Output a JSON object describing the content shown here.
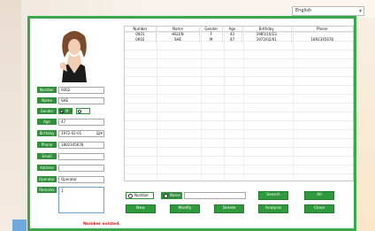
{
  "language": {
    "selected": "English"
  },
  "form": {
    "number_label": "Number",
    "number_value": "0002",
    "name_label": "Name",
    "name_value": "SHE",
    "gender_label": "Gender",
    "gender_option_male": "M",
    "gender_option_female": "",
    "age_label": "Age",
    "age_value": "47",
    "birthday_label": "Birthday",
    "birthday_value": "1972-02-01",
    "phone_label": "Phone",
    "phone_value": "1892345678",
    "email_label": "Email",
    "email_value": "",
    "address_label": "Address",
    "address_value": "",
    "operator_label": "Operator",
    "operator_value": "Operator",
    "remarks_label": "Remarks",
    "remarks_value": "1"
  },
  "table": {
    "columns": [
      "Number",
      "Name",
      "Gender",
      "Age",
      "Birthday",
      "Phone"
    ],
    "rows": [
      [
        "0001",
        "HELEN",
        "F",
        "43",
        "1985/10/23",
        ""
      ],
      [
        "0002",
        "SHE",
        "M",
        "47",
        "1972/02/01",
        "1892345678"
      ]
    ]
  },
  "search": {
    "option_number": "Number",
    "option_name": "Name",
    "query": ""
  },
  "buttons": {
    "search": "Search",
    "all": "All",
    "new": "New",
    "modify": "Modify",
    "delete": "Delete",
    "analysis": "Analysis",
    "close": "Close"
  },
  "status_message": "Number existed.",
  "colors": {
    "accent_green": "#2f8f3a",
    "window_border": "#3aa84a",
    "error_red": "#d02020"
  }
}
